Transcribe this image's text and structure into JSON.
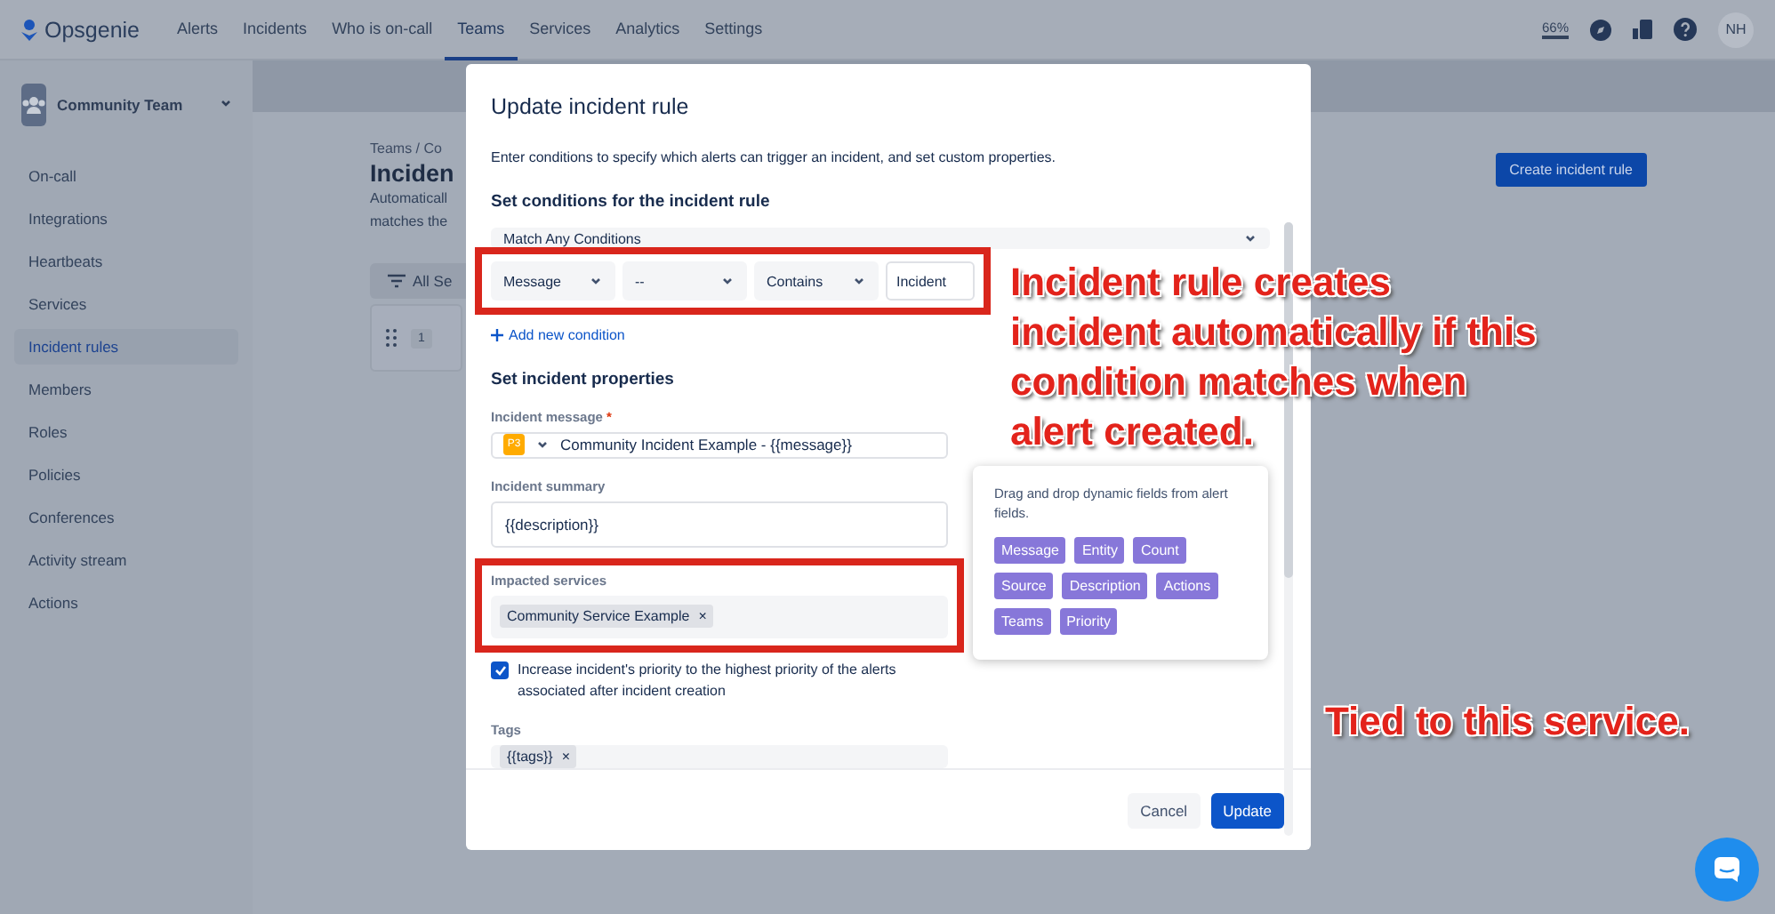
{
  "nav": {
    "logo": "Opsgenie",
    "items": [
      {
        "label": "Alerts",
        "selected": false
      },
      {
        "label": "Incidents",
        "selected": false
      },
      {
        "label": "Who is on-call",
        "selected": false
      },
      {
        "label": "Teams",
        "selected": true
      },
      {
        "label": "Services",
        "selected": false
      },
      {
        "label": "Analytics",
        "selected": false
      },
      {
        "label": "Settings",
        "selected": false
      }
    ],
    "usage": "66%",
    "avatar": "NH"
  },
  "sidebar": {
    "team": "Community Team",
    "items": [
      {
        "label": "On-call",
        "selected": false
      },
      {
        "label": "Integrations",
        "selected": false
      },
      {
        "label": "Heartbeats",
        "selected": false
      },
      {
        "label": "Services",
        "selected": false
      },
      {
        "label": "Incident rules",
        "selected": true
      },
      {
        "label": "Members",
        "selected": false
      },
      {
        "label": "Roles",
        "selected": false
      },
      {
        "label": "Policies",
        "selected": false
      },
      {
        "label": "Conferences",
        "selected": false
      },
      {
        "label": "Activity stream",
        "selected": false
      },
      {
        "label": "Actions",
        "selected": false
      }
    ]
  },
  "main": {
    "breadcrumb": "Teams / Co",
    "heading": "Inciden",
    "description": [
      "Automaticall",
      "matches the"
    ],
    "create_button": "Create incident rule",
    "filter": "All Se",
    "row_number": "1"
  },
  "modal": {
    "title": "Update incident rule",
    "description": "Enter conditions to specify which alerts can trigger an incident, and set custom properties.",
    "conditions_heading": "Set conditions for the incident rule",
    "match": "Match Any Conditions",
    "condition": {
      "field": "Message",
      "not": "--",
      "operator": "Contains",
      "value": "Incident"
    },
    "add_condition": "Add new condition",
    "properties_heading": "Set incident properties",
    "message_label": "Incident message",
    "required_mark": "*",
    "priority": "P3",
    "message": "Community Incident Example - {{message}}",
    "summary_label": "Incident summary",
    "summary": "{{description}}",
    "services_label": "Impacted services",
    "services": [
      "Community Service Example"
    ],
    "remove_mark": "×",
    "increase_priority": {
      "label": "Increase incident's priority to the highest priority of the alerts associated after incident creation",
      "checked": true
    },
    "tags_label": "Tags",
    "tags": [
      "{{tags}}"
    ],
    "buttons": {
      "cancel": "Cancel",
      "update": "Update"
    }
  },
  "popover": {
    "text": "Drag and drop dynamic fields from alert fields.",
    "fields": [
      "Message",
      "Entity",
      "Count",
      "Source",
      "Description",
      "Actions",
      "Teams",
      "Priority"
    ]
  },
  "annotations": [
    {
      "text": "Incident rule creates incident automatically if this condition matches when alert created."
    },
    {
      "text": "Tied to this service."
    }
  ]
}
